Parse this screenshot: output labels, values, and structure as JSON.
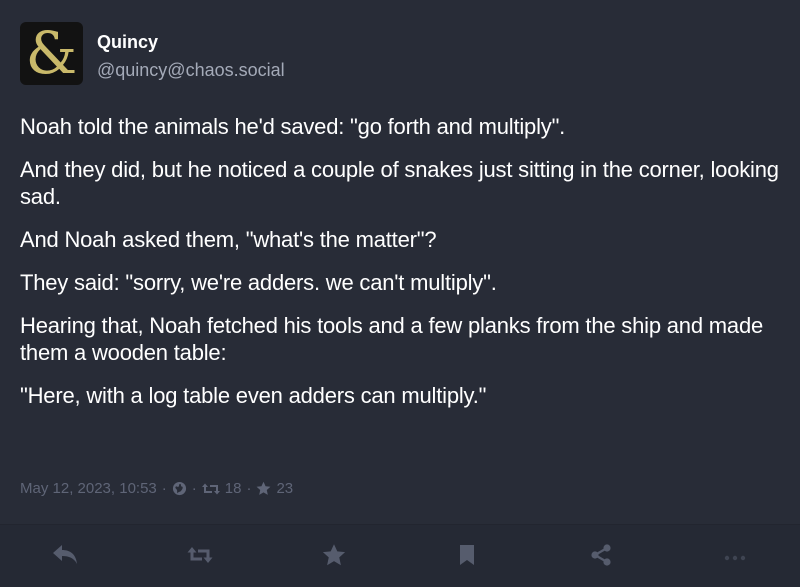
{
  "author": {
    "display_name": "Quincy",
    "handle": "@quincy@chaos.social",
    "avatar_glyph": "&",
    "avatar_color": "#c9b96a"
  },
  "post": {
    "paragraphs": [
      "Noah told the animals he'd saved: \"go forth and multiply\".",
      "And they did, but he noticed a couple of snakes just sitting in the corner, looking sad.",
      "And Noah asked them, \"what's the matter\"?",
      "They said: \"sorry, we're adders. we can't multiply\".",
      "Hearing that, Noah fetched his tools and a few planks from the ship and made them a wooden table:",
      "\"Here, with a log table even adders can multiply.\""
    ]
  },
  "meta": {
    "timestamp": "May 12, 2023, 10:53",
    "separator": "·",
    "visibility_icon": "globe-icon",
    "boost_icon": "boost-icon",
    "boost_count": "18",
    "favourite_icon": "star-icon",
    "favourite_count": "23"
  },
  "actions": [
    {
      "name": "reply",
      "icon": "reply-icon"
    },
    {
      "name": "boost",
      "icon": "boost-icon"
    },
    {
      "name": "favourite",
      "icon": "star-icon"
    },
    {
      "name": "bookmark",
      "icon": "bookmark-icon"
    },
    {
      "name": "share",
      "icon": "share-icon"
    },
    {
      "name": "more",
      "icon": "ellipsis-icon"
    }
  ],
  "colors": {
    "background": "#282c37",
    "text": "#ffffff",
    "secondary": "#a4aab8",
    "muted": "#5f6577"
  }
}
